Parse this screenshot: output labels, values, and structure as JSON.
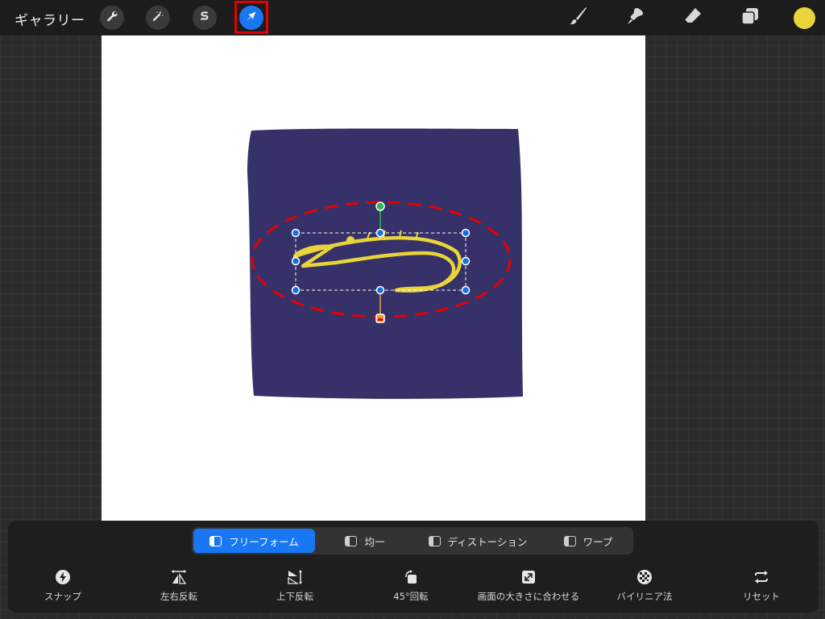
{
  "topbar": {
    "gallery_label": "ギャラリー",
    "left_tools": [
      {
        "icon": "wrench-icon",
        "name": "actions"
      },
      {
        "icon": "magic-wand-icon",
        "name": "adjustments"
      },
      {
        "icon": "selection-s-icon",
        "name": "selection"
      },
      {
        "icon": "transform-arrow-icon",
        "name": "transform",
        "active": true
      }
    ],
    "right_tools": [
      {
        "icon": "brush-icon",
        "name": "paint"
      },
      {
        "icon": "smudge-icon",
        "name": "smudge"
      },
      {
        "icon": "eraser-icon",
        "name": "erase"
      },
      {
        "icon": "layers-icon",
        "name": "layers"
      }
    ],
    "current_color": "#e8d53a"
  },
  "annotation": {
    "highlight_color": "#e60000"
  },
  "canvas": {
    "background": "#ffffff",
    "shape_color": "#363169",
    "stroke_color": "#e8d53a",
    "selection_handle_color": "#1c6fd8"
  },
  "transform_panel": {
    "modes": [
      {
        "label": "フリーフォーム",
        "active": true
      },
      {
        "label": "均一",
        "active": false
      },
      {
        "label": "ディストーション",
        "active": false
      },
      {
        "label": "ワープ",
        "active": false
      }
    ],
    "actions": [
      {
        "label": "スナップ",
        "icon": "lightning-icon"
      },
      {
        "label": "左右反転",
        "icon": "flip-horizontal-icon"
      },
      {
        "label": "上下反転",
        "icon": "flip-vertical-icon"
      },
      {
        "label": "45°回転",
        "icon": "rotate-icon"
      },
      {
        "label": "画面の大きさに合わせる",
        "icon": "fit-to-screen-icon"
      },
      {
        "label": "バイリニア法",
        "icon": "interpolation-icon"
      },
      {
        "label": "リセット",
        "icon": "reset-icon"
      }
    ]
  }
}
